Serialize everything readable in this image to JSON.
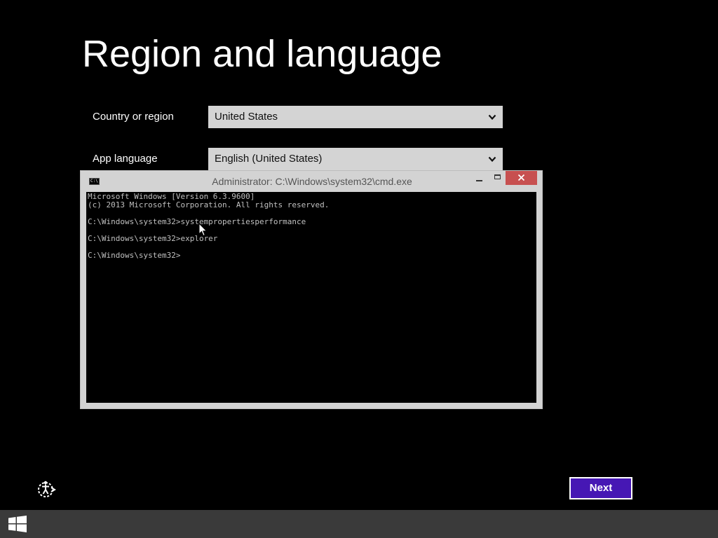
{
  "page": {
    "title": "Region and language"
  },
  "fields": [
    {
      "label": "Country or region",
      "value": "United States"
    },
    {
      "label": "App language",
      "value": "English (United States)"
    }
  ],
  "cmd": {
    "title": "Administrator: C:\\Windows\\system32\\cmd.exe",
    "icon_text": "C:\\",
    "lines": [
      "Microsoft Windows [Version 6.3.9600]",
      "(c) 2013 Microsoft Corporation. All rights reserved.",
      "",
      "C:\\Windows\\system32>systempropertiesperformance",
      "",
      "C:\\Windows\\system32>explorer",
      "",
      "C:\\Windows\\system32>"
    ],
    "close_color": "#c75050"
  },
  "footer": {
    "next_label": "Next",
    "next_color": "#4617b4",
    "ease_of_access_icon": "ease-of-access-icon"
  },
  "taskbar": {
    "start_icon": "windows-logo-icon",
    "background": "#3a3a3a"
  }
}
